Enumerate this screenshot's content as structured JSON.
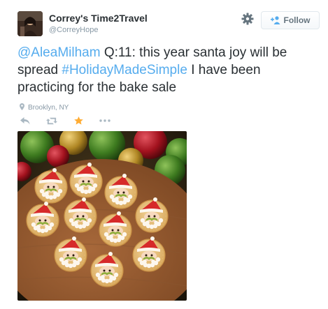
{
  "user": {
    "display_name": "Correy's Time2Travel",
    "handle": "@CorreyHope"
  },
  "follow_button": {
    "label": "Follow"
  },
  "tweet": {
    "mention": "@AleaMilham",
    "text_part1": " Q:11: this year santa joy will be spread  ",
    "hashtag": "#HolidayMadeSimple",
    "text_part2": " I have been practicing  for the bake sale"
  },
  "location": {
    "label": "Brooklyn, NY"
  },
  "colors": {
    "link": "#55acee",
    "favorite_active": "#ffac33",
    "muted": "#8899a6"
  },
  "icons": [
    "gear-icon",
    "person-add-icon",
    "map-pin-icon",
    "reply-icon",
    "retweet-icon",
    "favorite-star-icon",
    "more-icon"
  ],
  "media": {
    "description_icon": "santa-cracker-photo"
  }
}
